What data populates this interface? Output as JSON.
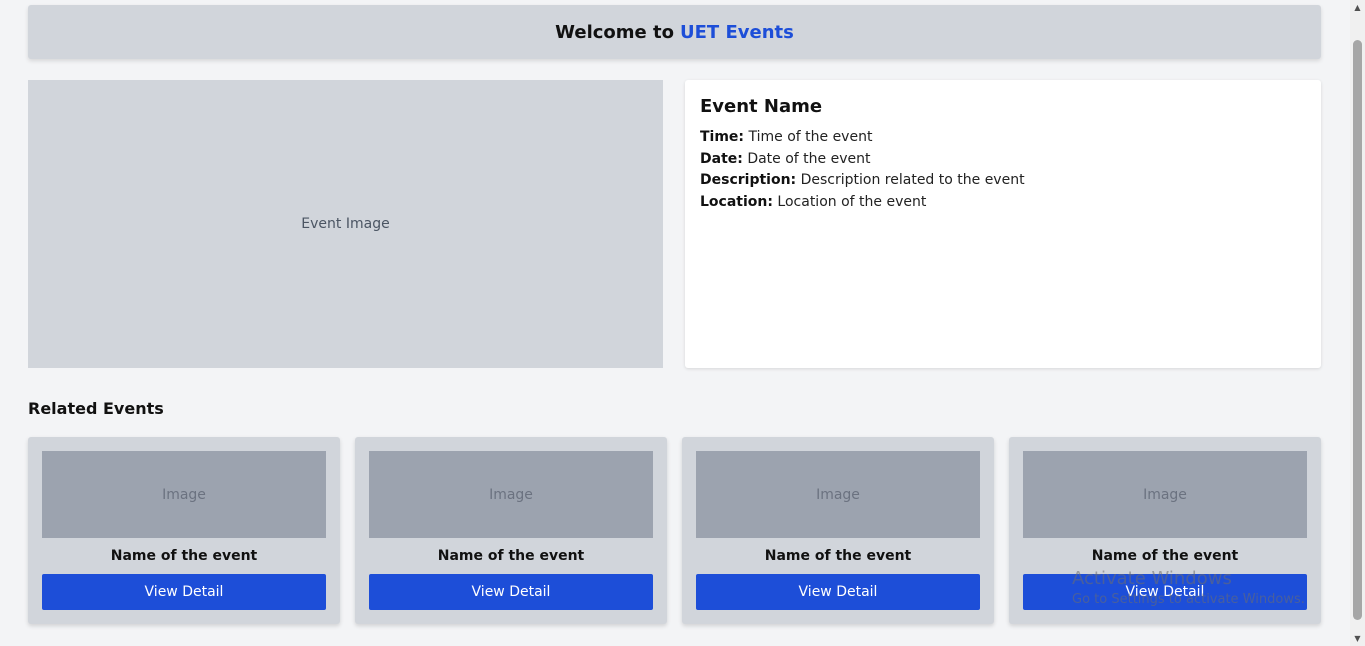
{
  "header": {
    "welcome_prefix": "Welcome to",
    "brand": "UET Events",
    "accent_color": "#1d4ed8"
  },
  "event": {
    "image_placeholder": "Event Image",
    "name": "Event Name",
    "time_label": "Time:",
    "time_value": "Time of the event",
    "date_label": "Date:",
    "date_value": "Date of the event",
    "description_label": "Description:",
    "description_value": "Description related to the event",
    "location_label": "Location:",
    "location_value": "Location of the event"
  },
  "related": {
    "title": "Related Events",
    "cards": [
      {
        "image": "Image",
        "name": "Name of the event",
        "button": "View Detail"
      },
      {
        "image": "Image",
        "name": "Name of the event",
        "button": "View Detail"
      },
      {
        "image": "Image",
        "name": "Name of the event",
        "button": "View Detail"
      },
      {
        "image": "Image",
        "name": "Name of the event",
        "button": "View Detail"
      }
    ]
  },
  "watermark": {
    "title": "Activate Windows",
    "subtitle": "Go to Settings to activate Windows."
  },
  "icons": {
    "scroll_up": "scroll-up-arrow-icon",
    "scroll_down": "scroll-down-arrow-icon"
  }
}
